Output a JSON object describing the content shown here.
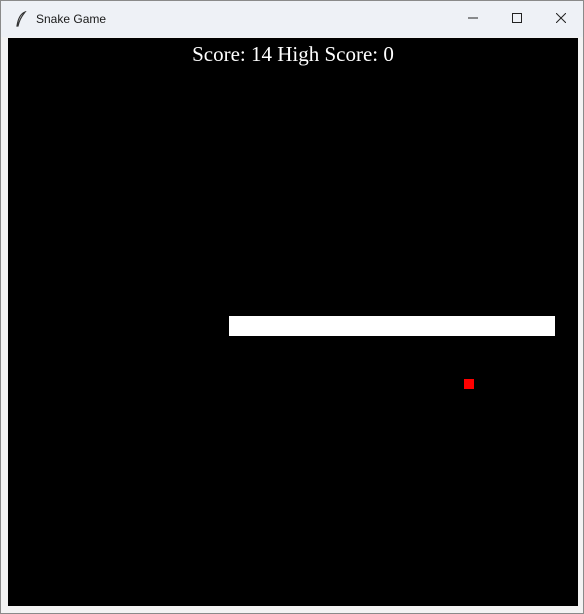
{
  "window": {
    "title": "Snake Game",
    "app_icon": "feather-icon",
    "controls": [
      "minimize-icon",
      "maximize-icon",
      "close-icon"
    ]
  },
  "game": {
    "score_text": "Score: 14 High Score: 0",
    "background_color": "#000000",
    "snake_color": "#ffffff",
    "food_color": "#ff0000"
  }
}
